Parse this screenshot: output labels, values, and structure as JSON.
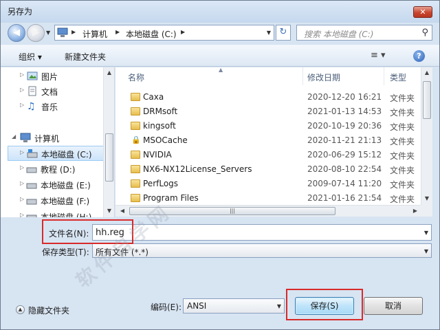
{
  "window": {
    "title": "另存为",
    "close_label": "✕"
  },
  "nav": {
    "back_icon": "back-arrow-icon",
    "forward_icon": "forward-arrow-icon"
  },
  "address": {
    "seg1": "计算机",
    "seg2": "本地磁盘 (C:)"
  },
  "search": {
    "placeholder": "搜索 本地磁盘 (C:)"
  },
  "toolbar": {
    "organize": "组织 ▾",
    "new_folder": "新建文件夹"
  },
  "sidebar": {
    "items": [
      {
        "label": "图片"
      },
      {
        "label": "文档"
      },
      {
        "label": "音乐"
      },
      {
        "label": "计算机"
      },
      {
        "label": "本地磁盘 (C:)"
      },
      {
        "label": "教程 (D:)"
      },
      {
        "label": "本地磁盘 (E:)"
      },
      {
        "label": "本地磁盘 (F:)"
      },
      {
        "label": "本地磁盘 (H:)"
      }
    ]
  },
  "files": {
    "columns": {
      "name": "名称",
      "date": "修改日期",
      "type": "类型"
    },
    "rows": [
      {
        "name": "Caxa",
        "date": "2020-12-20 16:21",
        "type": "文件夹"
      },
      {
        "name": "DRMsoft",
        "date": "2021-01-13 14:53",
        "type": "文件夹"
      },
      {
        "name": "kingsoft",
        "date": "2020-10-19 20:36",
        "type": "文件夹"
      },
      {
        "name": "MSOCache",
        "date": "2020-11-21 21:13",
        "type": "文件夹"
      },
      {
        "name": "NVIDIA",
        "date": "2020-06-29 15:12",
        "type": "文件夹"
      },
      {
        "name": "NX6-NX12License_Servers",
        "date": "2020-08-10 22:54",
        "type": "文件夹"
      },
      {
        "name": "PerfLogs",
        "date": "2009-07-14 11:20",
        "type": "文件夹"
      },
      {
        "name": "Program Files",
        "date": "2021-01-16 21:54",
        "type": "文件夹"
      }
    ]
  },
  "form": {
    "filename_label": "文件名(N):",
    "filename_value": "hh.reg",
    "filetype_label": "保存类型(T):",
    "filetype_value": "所有文件  (*.*)",
    "encoding_label": "编码(E):",
    "encoding_value": "ANSI"
  },
  "footer": {
    "hide_folders": "隐藏文件夹",
    "save": "保存(S)",
    "cancel": "取消"
  },
  "watermark": "软件自学网",
  "colors": {
    "highlight": "#d82a2a",
    "selection": "#cde4fa"
  }
}
